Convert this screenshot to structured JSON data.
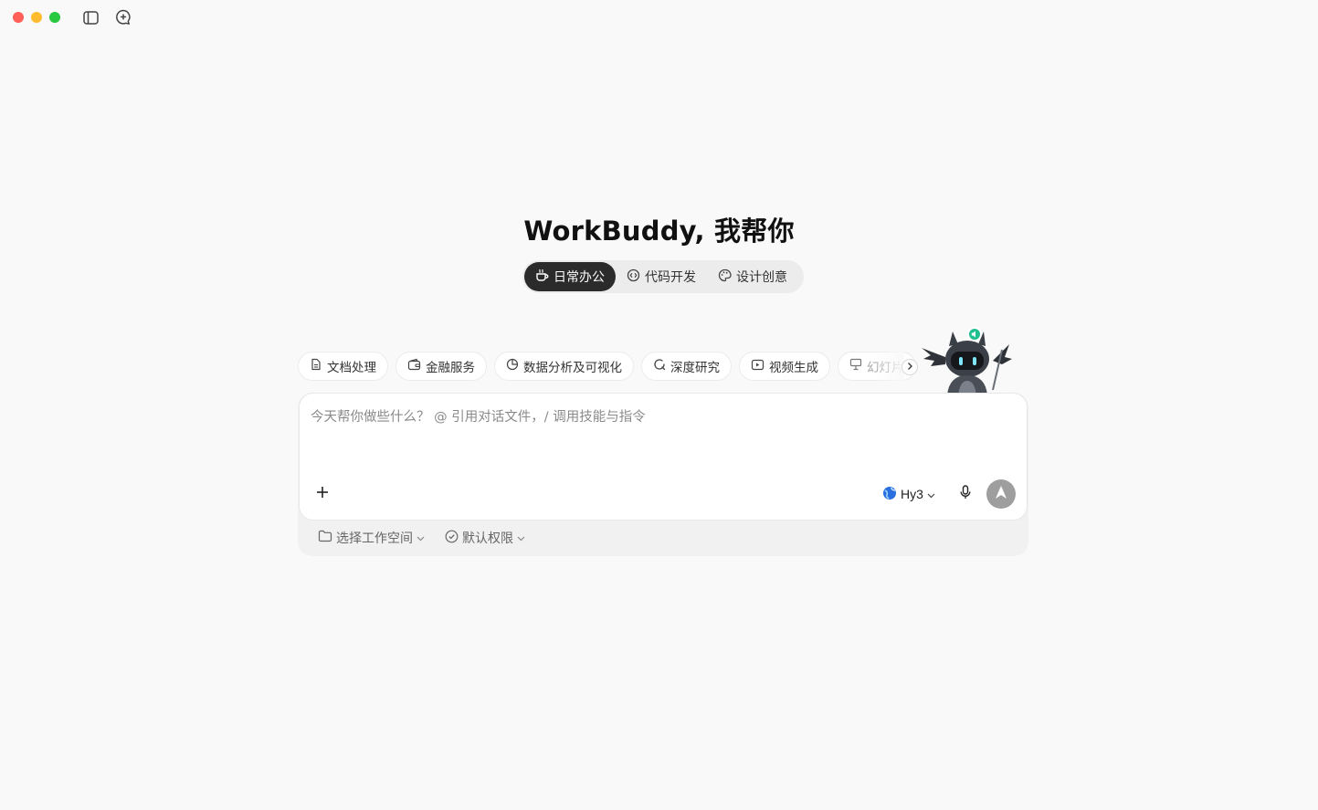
{
  "window": {
    "traffic_lights": {
      "close": "#ff5f57",
      "minimize": "#febc2e",
      "maximize": "#28c840"
    },
    "toolbar_icons": [
      "sidebar-toggle-icon",
      "new-chat-icon"
    ]
  },
  "hero": {
    "title": "WorkBuddy, 我帮你"
  },
  "modes": {
    "active_index": 0,
    "tabs": [
      {
        "label": "日常办公",
        "icon": "coffee-cup-icon"
      },
      {
        "label": "代码开发",
        "icon": "code-icon"
      },
      {
        "label": "设计创意",
        "icon": "palette-icon"
      }
    ]
  },
  "chips": [
    {
      "label": "文档处理",
      "icon": "document-icon"
    },
    {
      "label": "金融服务",
      "icon": "wallet-icon"
    },
    {
      "label": "数据分析及可视化",
      "icon": "pie-chart-icon"
    },
    {
      "label": "深度研究",
      "icon": "research-icon"
    },
    {
      "label": "视频生成",
      "icon": "video-icon"
    },
    {
      "label": "幻灯片",
      "icon": "presentation-icon"
    }
  ],
  "composer": {
    "placeholder": "今天帮你做些什么？ @ 引用对话文件，/ 调用技能与指令",
    "value": "",
    "model": "Hy3"
  },
  "bottom_bar": {
    "workspace_label": "选择工作空间",
    "permission_label": "默认权限"
  },
  "colors": {
    "background": "#f9f9f9",
    "active_tab": "#2b2b2b",
    "send_button": "#9e9e9e",
    "mascot_badge": "#1fbf8f"
  }
}
